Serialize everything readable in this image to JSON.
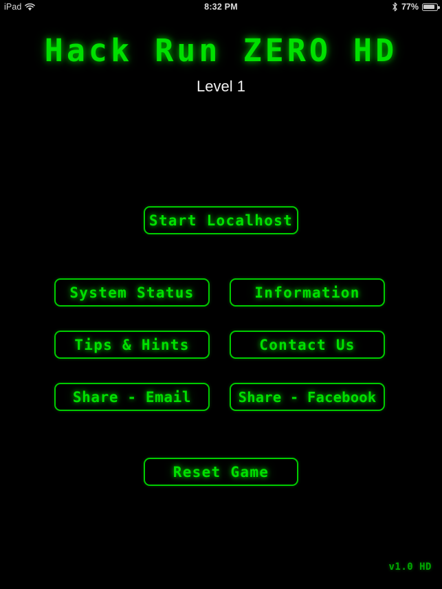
{
  "status_bar": {
    "carrier": "iPad",
    "wifi_icon": "wifi-icon",
    "time": "8:32 PM",
    "bluetooth_icon": "bluetooth-icon",
    "battery_percent": "77%",
    "battery_level": 77,
    "battery_icon": "battery-icon"
  },
  "header": {
    "title": "Hack Run ZERO HD",
    "level": "Level 1"
  },
  "menu": {
    "start": "Start Localhost",
    "system_status": "System Status",
    "information": "Information",
    "tips_hints": "Tips & Hints",
    "contact_us": "Contact Us",
    "share_email": "Share - Email",
    "share_facebook": "Share - Facebook",
    "reset_game": "Reset Game"
  },
  "footer": {
    "version": "v1.0 HD"
  },
  "colors": {
    "background": "#000000",
    "accent_green": "#00cc00",
    "text_green": "#00e000",
    "dim_green": "#00a800",
    "status_text": "#d4d4d4",
    "level_text": "#f2f2f2"
  }
}
